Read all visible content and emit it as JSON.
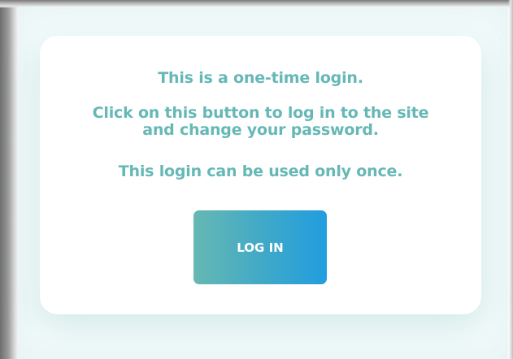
{
  "card": {
    "line1": "This is a one-time login.",
    "line2a": "Click on this button to log in to the site",
    "line2b": "and change your password.",
    "line3": "This login can be used only once.",
    "button_label": "LOG IN"
  },
  "colors": {
    "text_accent": "#66b8b6",
    "button_gradient_start": "#66b8b2",
    "button_gradient_end": "#229ddf"
  }
}
